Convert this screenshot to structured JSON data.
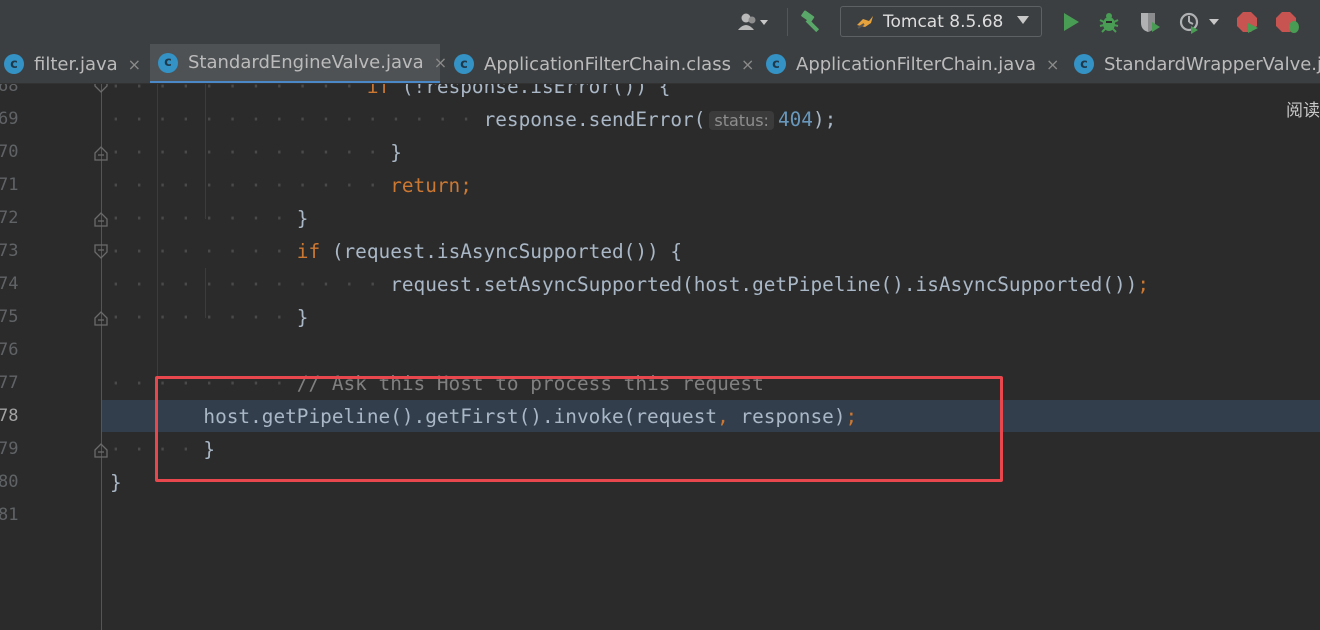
{
  "toolbar": {
    "run_config_label": "Tomcat 8.5.68",
    "icons": [
      "user-icon",
      "build-hammer-icon",
      "run-icon",
      "debug-icon",
      "coverage-icon",
      "profile-icon",
      "stop-icon"
    ]
  },
  "tabs": [
    {
      "label": "filter.java",
      "close": "×",
      "active": false
    },
    {
      "label": "StandardEngineValve.java",
      "close": "×",
      "active": true
    },
    {
      "label": "ApplicationFilterChain.class",
      "close": "×",
      "active": false
    },
    {
      "label": "ApplicationFilterChain.java",
      "close": "×",
      "active": false
    },
    {
      "label": "StandardWrapperValve.ja",
      "active": false
    }
  ],
  "tab_icon_letter": "c",
  "side_label": "阅读",
  "param_hint": "status:",
  "code_lines": [
    {
      "num": "68"
    },
    {
      "num": "69",
      "method": "response.sendError(",
      "value": "404",
      "end": ");"
    },
    {
      "num": "70",
      "text": "}"
    },
    {
      "num": "71",
      "kw": "return",
      "punct": ";"
    },
    {
      "num": "72",
      "text": "}"
    },
    {
      "num": "73",
      "kw": "if",
      "rest": " (request.isAsyncSupported()) {"
    },
    {
      "num": "74",
      "text": "request.setAsyncSupported(host.getPipeline().isAsyncSupported())",
      "punct": ";"
    },
    {
      "num": "75",
      "text": "}"
    },
    {
      "num": "76"
    },
    {
      "num": "77",
      "comment": "// Ask this Host to process this request"
    },
    {
      "num": "78",
      "text_a": "host.getPipeline().getFirst().invoke(request",
      "comma": ",",
      "text_b": " response)",
      "punct": ";"
    },
    {
      "num": "79",
      "text": "}"
    },
    {
      "num": "80",
      "text": "}"
    },
    {
      "num": "81"
    }
  ],
  "colors": {
    "background": "#2b2b2b",
    "keyword": "#cc7832",
    "number": "#6897bb",
    "comment": "#808080",
    "plain": "#a9b7c6",
    "annotation_border": "#e8484d",
    "current_line": "#323e4c"
  }
}
